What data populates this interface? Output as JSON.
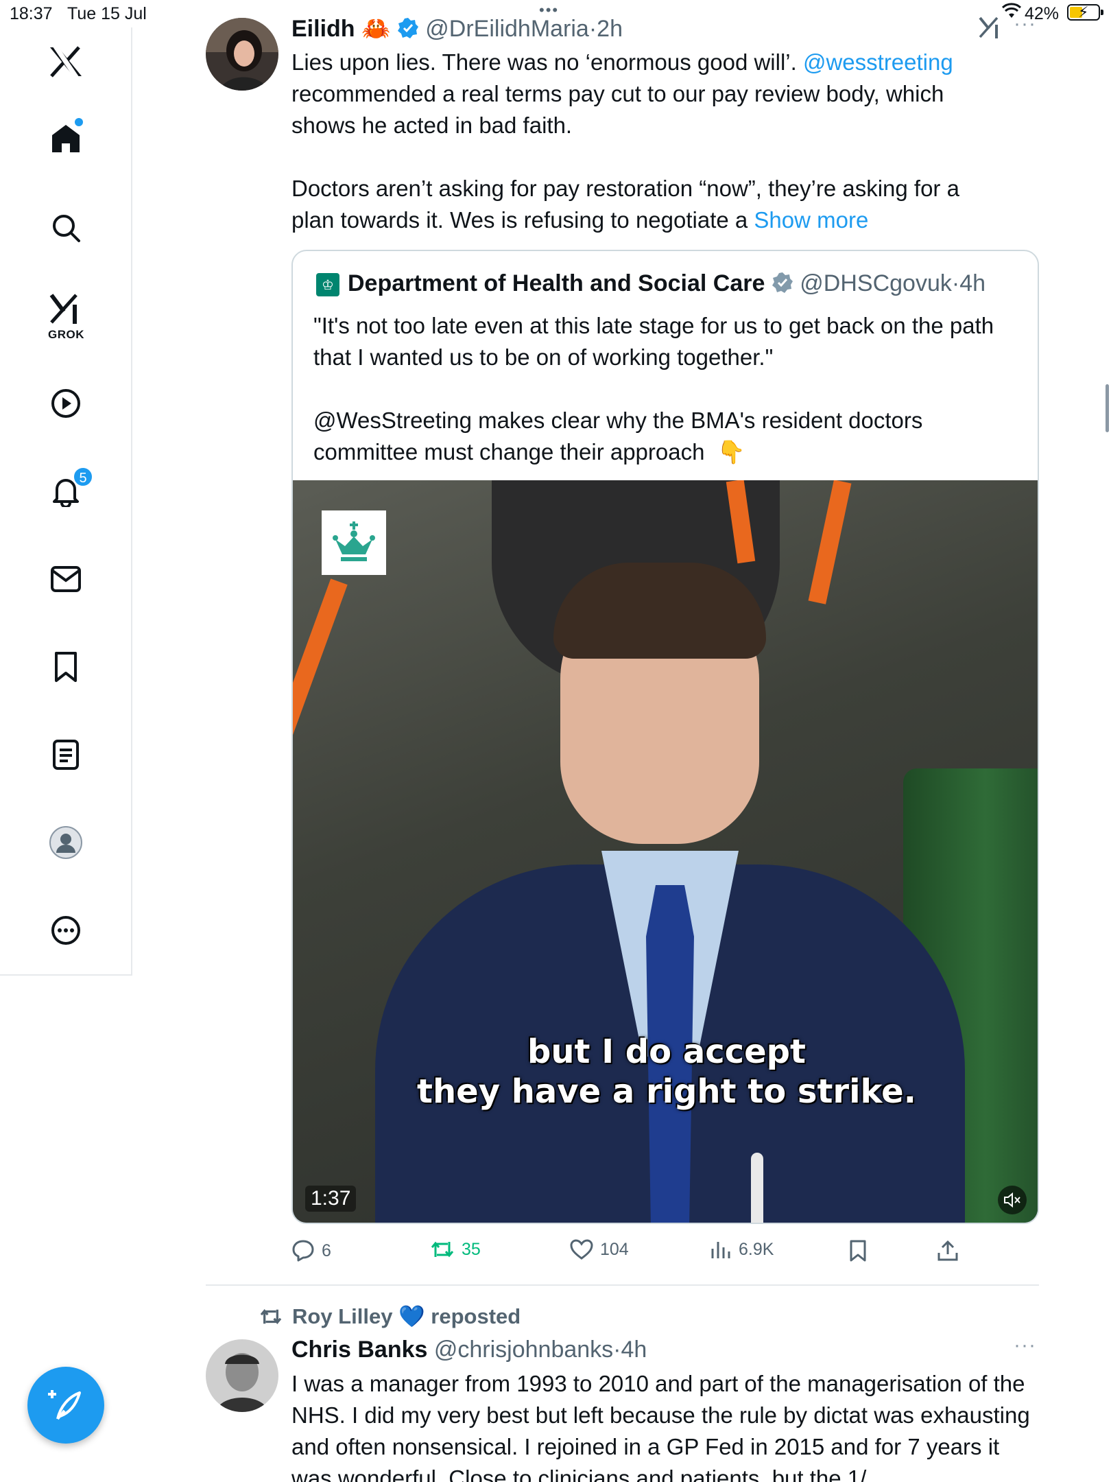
{
  "status_bar": {
    "time": "18:37",
    "date": "Tue 15 Jul",
    "battery": "42%"
  },
  "sidebar": {
    "grok_label": "GROK",
    "notifications_badge": "5",
    "items": [
      "x-logo",
      "home",
      "search",
      "grok",
      "video",
      "notifications",
      "messages",
      "bookmarks",
      "lists",
      "profile",
      "more"
    ]
  },
  "tweet1": {
    "name": "Eilidh",
    "emoji": "🦀",
    "handle": "@DrEilidhMaria",
    "sep": "·",
    "time": "2h",
    "text_l1a": "Lies upon lies. There was no ‘enormous good will’. ",
    "mention": "@wesstreeting",
    "text_l1b": " recommended a real terms pay cut to our pay review body, which shows he acted in bad faith.",
    "text_p2": "Doctors aren’t asking for pay restoration “now”, they’re asking for a plan towards it. Wes is refusing to negotiate a ",
    "show_more": "Show more",
    "quote": {
      "name": "Department of Health and Social Care",
      "handle": "@DHSCgovuk",
      "sep": "·",
      "time": "4h",
      "text_p1": "\"It's not too late even at this late stage for us to get back on the path that I wanted us to be on of working together.\"",
      "text_p2": "@WesStreeting makes clear why the BMA's resident doctors committee must change their approach",
      "emoji": "👇",
      "video": {
        "caption_l1": "but I do accept",
        "caption_l2": "they have a right to strike.",
        "duration": "1:37"
      }
    },
    "actions": {
      "replies": "6",
      "reposts": "35",
      "likes": "104",
      "views": "6.9K"
    }
  },
  "tweet2": {
    "reposted_by": "Roy Lilley",
    "reposted_emoji": "💙",
    "reposted_label": "reposted",
    "name": "Chris Banks",
    "handle": "@chrisjohnbanks",
    "sep": "·",
    "time": "4h",
    "text": "I was a manager from 1993 to 2010 and part of the managerisation of the NHS. I did my very best but left because the rule by dictat was exhausting and often nonsensical. I rejoined in a GP Fed in 2015 and for 7 years it was wonderful. Close to clinicians and patients, but the 1/"
  },
  "colors": {
    "accent": "#1d9bf0",
    "repost_green": "#00ba7c",
    "muted": "#536471",
    "border": "#cfd9de"
  }
}
